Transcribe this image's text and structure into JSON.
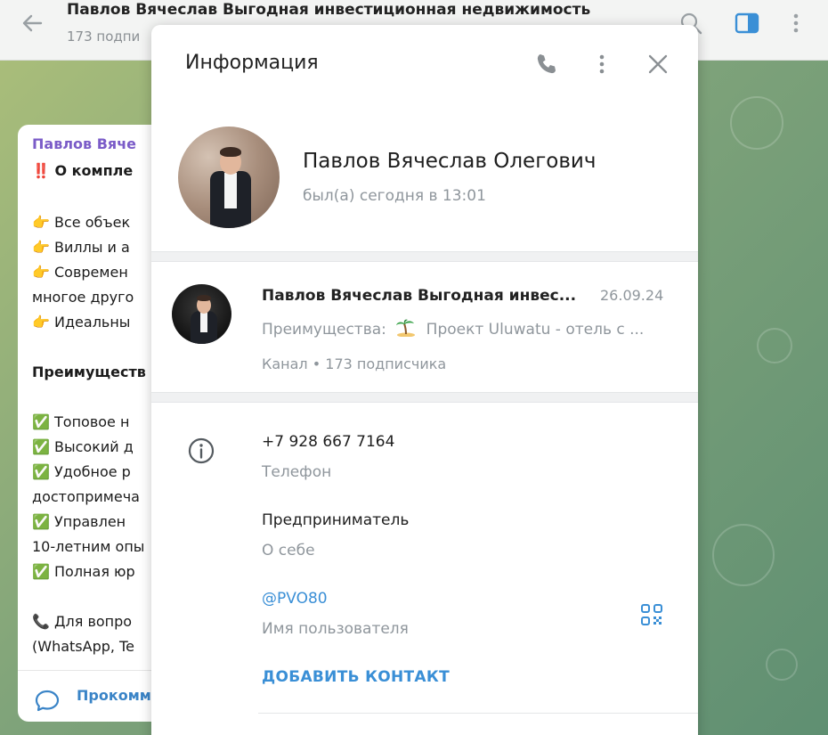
{
  "background": {
    "header": {
      "title": "Павлов Вячеслав Выгодная инвестиционная недвижимость",
      "subtitle": "173 подпи"
    },
    "post": {
      "sender": "Павлов Вяче",
      "lines": [
        "‼️ О компле",
        "👉 Все объек",
        "👉 Виллы и а",
        "👉 Современ",
        "многое друго",
        "👉 Идеальны",
        "Преимуществ",
        "✅ Топовое н",
        "✅ Высокий д",
        "✅ Удобное р",
        "достопримеча",
        "✅ Управлен",
        "10-летним опы",
        "✅ Полная юр",
        "📞 Для вопро",
        "(WhatsApp, Te"
      ],
      "comment_label": "Прокомм"
    }
  },
  "panel": {
    "title": "Информация",
    "profile": {
      "name": "Павлов Вячеслав Олегович",
      "status": "был(а) сегодня в 13:01"
    },
    "channel": {
      "name": "Павлов Вячеслав Выгодная инвес...",
      "date": "26.09.24",
      "preview_prefix": "Преимущества:",
      "preview_text": "Проект Uluwatu - отель с ...",
      "meta": "Канал • 173 подписчика"
    },
    "fields": {
      "phone_value": "+7 928 667 7164",
      "phone_label": "Телефон",
      "bio_value": "Предприниматель",
      "bio_label": "О себе",
      "username_value": "@PVO80",
      "username_label": "Имя пользователя"
    },
    "add_contact_label": "ДОБАВИТЬ КОНТАКТ"
  },
  "colors": {
    "accent": "#3a8fd6",
    "sender": "#7b5cc8",
    "muted": "#8f969c"
  },
  "icons": [
    "back-arrow-icon",
    "search-icon",
    "sidebar-toggle-icon",
    "more-vertical-icon",
    "phone-icon",
    "close-icon",
    "info-icon",
    "qr-code-icon",
    "comment-icon",
    "palm-tree-icon"
  ]
}
